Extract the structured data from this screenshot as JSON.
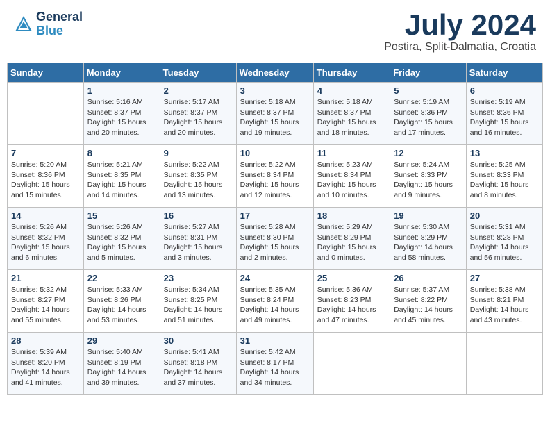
{
  "header": {
    "logo_general": "General",
    "logo_blue": "Blue",
    "month_title": "July 2024",
    "location": "Postira, Split-Dalmatia, Croatia"
  },
  "weekdays": [
    "Sunday",
    "Monday",
    "Tuesday",
    "Wednesday",
    "Thursday",
    "Friday",
    "Saturday"
  ],
  "weeks": [
    [
      {
        "day": "",
        "info": ""
      },
      {
        "day": "1",
        "info": "Sunrise: 5:16 AM\nSunset: 8:37 PM\nDaylight: 15 hours\nand 20 minutes."
      },
      {
        "day": "2",
        "info": "Sunrise: 5:17 AM\nSunset: 8:37 PM\nDaylight: 15 hours\nand 20 minutes."
      },
      {
        "day": "3",
        "info": "Sunrise: 5:18 AM\nSunset: 8:37 PM\nDaylight: 15 hours\nand 19 minutes."
      },
      {
        "day": "4",
        "info": "Sunrise: 5:18 AM\nSunset: 8:37 PM\nDaylight: 15 hours\nand 18 minutes."
      },
      {
        "day": "5",
        "info": "Sunrise: 5:19 AM\nSunset: 8:36 PM\nDaylight: 15 hours\nand 17 minutes."
      },
      {
        "day": "6",
        "info": "Sunrise: 5:19 AM\nSunset: 8:36 PM\nDaylight: 15 hours\nand 16 minutes."
      }
    ],
    [
      {
        "day": "7",
        "info": "Sunrise: 5:20 AM\nSunset: 8:36 PM\nDaylight: 15 hours\nand 15 minutes."
      },
      {
        "day": "8",
        "info": "Sunrise: 5:21 AM\nSunset: 8:35 PM\nDaylight: 15 hours\nand 14 minutes."
      },
      {
        "day": "9",
        "info": "Sunrise: 5:22 AM\nSunset: 8:35 PM\nDaylight: 15 hours\nand 13 minutes."
      },
      {
        "day": "10",
        "info": "Sunrise: 5:22 AM\nSunset: 8:34 PM\nDaylight: 15 hours\nand 12 minutes."
      },
      {
        "day": "11",
        "info": "Sunrise: 5:23 AM\nSunset: 8:34 PM\nDaylight: 15 hours\nand 10 minutes."
      },
      {
        "day": "12",
        "info": "Sunrise: 5:24 AM\nSunset: 8:33 PM\nDaylight: 15 hours\nand 9 minutes."
      },
      {
        "day": "13",
        "info": "Sunrise: 5:25 AM\nSunset: 8:33 PM\nDaylight: 15 hours\nand 8 minutes."
      }
    ],
    [
      {
        "day": "14",
        "info": "Sunrise: 5:26 AM\nSunset: 8:32 PM\nDaylight: 15 hours\nand 6 minutes."
      },
      {
        "day": "15",
        "info": "Sunrise: 5:26 AM\nSunset: 8:32 PM\nDaylight: 15 hours\nand 5 minutes."
      },
      {
        "day": "16",
        "info": "Sunrise: 5:27 AM\nSunset: 8:31 PM\nDaylight: 15 hours\nand 3 minutes."
      },
      {
        "day": "17",
        "info": "Sunrise: 5:28 AM\nSunset: 8:30 PM\nDaylight: 15 hours\nand 2 minutes."
      },
      {
        "day": "18",
        "info": "Sunrise: 5:29 AM\nSunset: 8:29 PM\nDaylight: 15 hours\nand 0 minutes."
      },
      {
        "day": "19",
        "info": "Sunrise: 5:30 AM\nSunset: 8:29 PM\nDaylight: 14 hours\nand 58 minutes."
      },
      {
        "day": "20",
        "info": "Sunrise: 5:31 AM\nSunset: 8:28 PM\nDaylight: 14 hours\nand 56 minutes."
      }
    ],
    [
      {
        "day": "21",
        "info": "Sunrise: 5:32 AM\nSunset: 8:27 PM\nDaylight: 14 hours\nand 55 minutes."
      },
      {
        "day": "22",
        "info": "Sunrise: 5:33 AM\nSunset: 8:26 PM\nDaylight: 14 hours\nand 53 minutes."
      },
      {
        "day": "23",
        "info": "Sunrise: 5:34 AM\nSunset: 8:25 PM\nDaylight: 14 hours\nand 51 minutes."
      },
      {
        "day": "24",
        "info": "Sunrise: 5:35 AM\nSunset: 8:24 PM\nDaylight: 14 hours\nand 49 minutes."
      },
      {
        "day": "25",
        "info": "Sunrise: 5:36 AM\nSunset: 8:23 PM\nDaylight: 14 hours\nand 47 minutes."
      },
      {
        "day": "26",
        "info": "Sunrise: 5:37 AM\nSunset: 8:22 PM\nDaylight: 14 hours\nand 45 minutes."
      },
      {
        "day": "27",
        "info": "Sunrise: 5:38 AM\nSunset: 8:21 PM\nDaylight: 14 hours\nand 43 minutes."
      }
    ],
    [
      {
        "day": "28",
        "info": "Sunrise: 5:39 AM\nSunset: 8:20 PM\nDaylight: 14 hours\nand 41 minutes."
      },
      {
        "day": "29",
        "info": "Sunrise: 5:40 AM\nSunset: 8:19 PM\nDaylight: 14 hours\nand 39 minutes."
      },
      {
        "day": "30",
        "info": "Sunrise: 5:41 AM\nSunset: 8:18 PM\nDaylight: 14 hours\nand 37 minutes."
      },
      {
        "day": "31",
        "info": "Sunrise: 5:42 AM\nSunset: 8:17 PM\nDaylight: 14 hours\nand 34 minutes."
      },
      {
        "day": "",
        "info": ""
      },
      {
        "day": "",
        "info": ""
      },
      {
        "day": "",
        "info": ""
      }
    ]
  ]
}
